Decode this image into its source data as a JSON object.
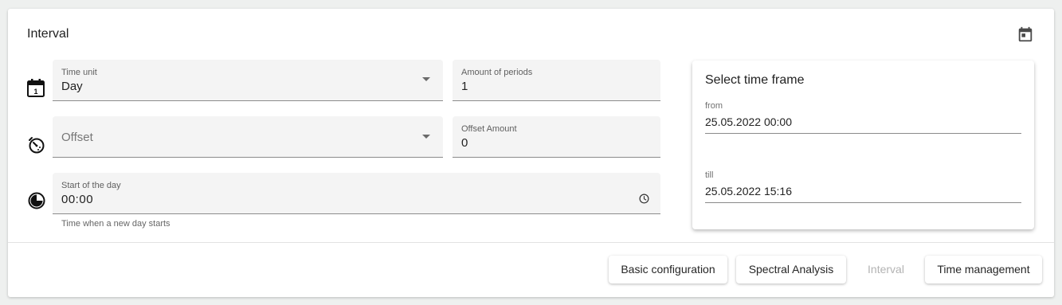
{
  "card": {
    "title": "Interval",
    "calendar_icon": "calendar-icon"
  },
  "time_unit": {
    "label": "Time unit",
    "value": "Day",
    "icon": "calendar-day-icon"
  },
  "amount_of_periods": {
    "label": "Amount of periods",
    "value": "1"
  },
  "offset": {
    "placeholder": "Offset",
    "icon": "timer-offset-icon"
  },
  "offset_amount": {
    "label": "Offset Amount",
    "value": "0"
  },
  "start_of_day": {
    "label": "Start of the day",
    "value": "00:00",
    "hint": "Time when a new day starts",
    "icon": "day-cycle-icon",
    "clock_icon": "clock-icon"
  },
  "time_frame": {
    "title": "Select time frame",
    "from_label": "from",
    "from_value": "25.05.2022 00:00",
    "till_label": "till",
    "till_value": "25.05.2022 15:16"
  },
  "tabs": {
    "basic": "Basic configuration",
    "spectral": "Spectral Analysis",
    "interval": "Interval",
    "time_management": "Time management"
  }
}
